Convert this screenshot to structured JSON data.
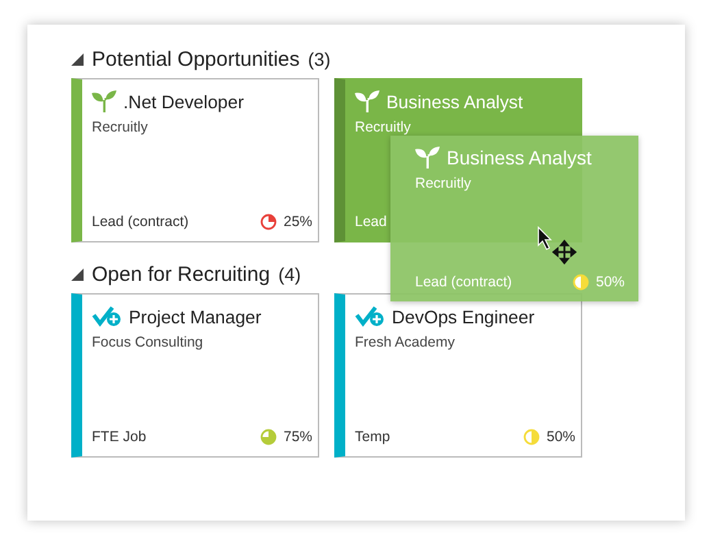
{
  "sections": [
    {
      "title": "Potential Opportunities",
      "count": "(3)",
      "kind": "potential",
      "expanded": true,
      "cards": [
        {
          "title": ".Net Developer",
          "company": "Recruitly",
          "type": "Lead (contract)",
          "percent": "25%",
          "color": "#e8403a",
          "selected": false
        },
        {
          "title": "Business Analyst",
          "company": "Recruitly",
          "type": "Lead",
          "selected": true
        }
      ]
    },
    {
      "title": "Open for Recruiting",
      "count": "(4)",
      "kind": "open",
      "expanded": true,
      "cards": [
        {
          "title": "Project Manager",
          "company": "Focus Consulting",
          "type": "FTE Job",
          "percent": "75%",
          "color": "#b5cc3a",
          "selected": false
        },
        {
          "title": "DevOps Engineer",
          "company": "Fresh Academy",
          "type": "Temp",
          "percent": "50%",
          "color": "#f5dc3a",
          "selected": false
        }
      ]
    }
  ],
  "drag_preview": {
    "kind": "potential",
    "title": "Business Analyst",
    "company": "Recruitly",
    "type": "Lead (contract)",
    "percent": "50%",
    "color": "#f5dc3a"
  }
}
